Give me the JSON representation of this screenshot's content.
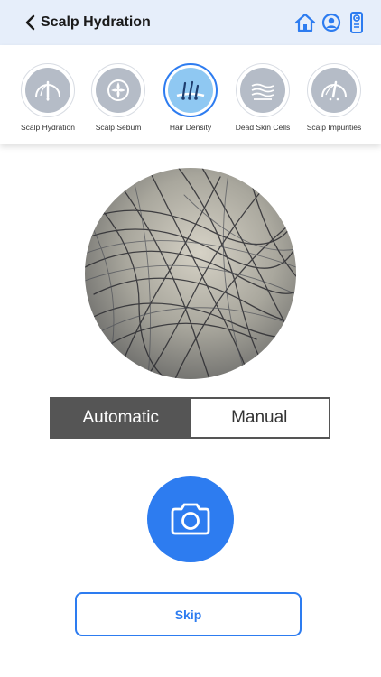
{
  "header": {
    "title": "Scalp Hydration"
  },
  "categories": [
    {
      "label": "Scalp Hydration",
      "icon": "scalp-hydration-icon"
    },
    {
      "label": "Scalp Sebum",
      "icon": "scalp-sebum-icon"
    },
    {
      "label": "Hair Density",
      "icon": "hair-density-icon",
      "active": true
    },
    {
      "label": "Dead Skin Cells",
      "icon": "dead-skin-cells-icon"
    },
    {
      "label": "Scalp Impurities",
      "icon": "scalp-impurities-icon"
    }
  ],
  "mode": {
    "automatic_label": "Automatic",
    "manual_label": "Manual",
    "selected": "Automatic"
  },
  "skip_label": "Skip",
  "colors": {
    "accent": "#2d7cf0",
    "header_bg": "#e6eefa",
    "toggle_active": "#555555"
  }
}
